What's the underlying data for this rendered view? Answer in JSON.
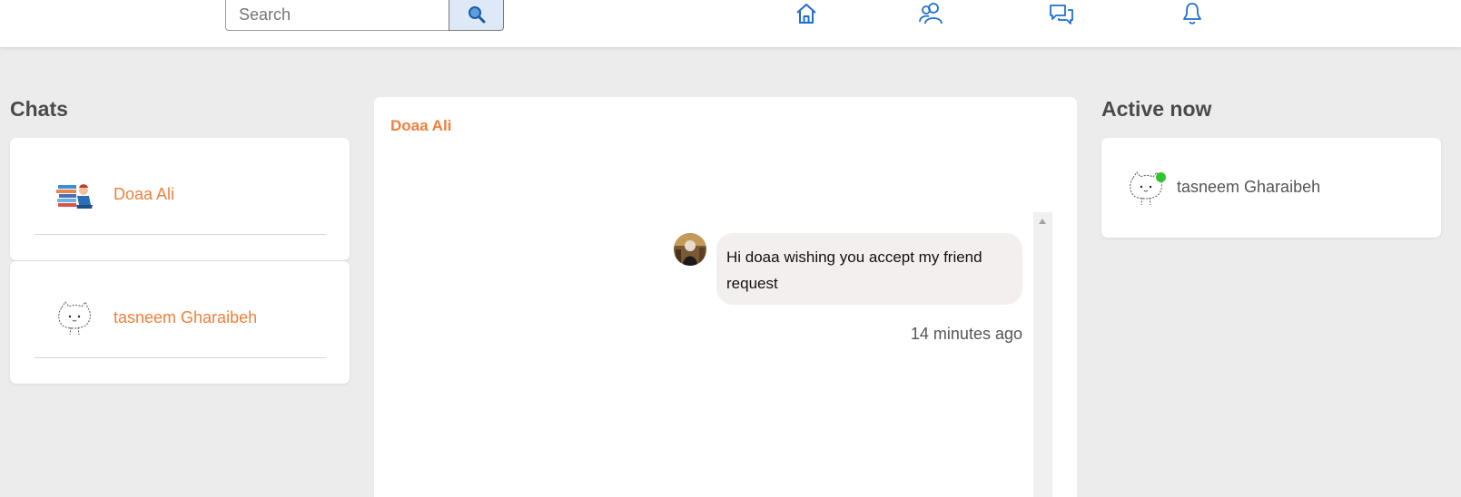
{
  "search": {
    "placeholder": "Search"
  },
  "nav": {
    "icons": [
      "home-icon",
      "friends-icon",
      "messages-icon",
      "notifications-icon"
    ]
  },
  "chats": {
    "title": "Chats",
    "items": [
      {
        "name": "Doaa Ali"
      },
      {
        "name": "tasneem Gharaibeh"
      }
    ]
  },
  "conversation": {
    "name": "Doaa Ali",
    "messages": [
      {
        "text": "Hi doaa wishing you accept my friend request",
        "time": "14 minutes ago"
      }
    ]
  },
  "active": {
    "title": "Active now",
    "users": [
      {
        "name": "tasneem Gharaibeh",
        "online": true
      }
    ]
  },
  "colors": {
    "accent": "#f07f3c",
    "nav_icon": "#1f6fd1",
    "online": "#31c42d",
    "bubble": "#f3efef",
    "page_bg": "#ececec"
  }
}
